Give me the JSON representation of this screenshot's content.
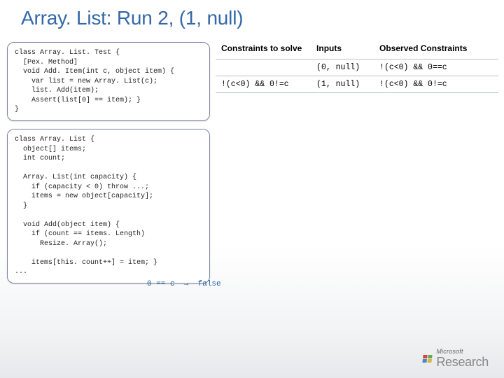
{
  "title": "Array. List: Run 2, (1, null)",
  "code1": "class Array. List. Test {\n  [Pex. Method]\n  void Add. Item(int c, object item) {\n    var list = new Array. List(c);\n    list. Add(item);\n    Assert(list[0] == item); }\n}",
  "code2": "class Array. List {\n  object[] items;\n  int count;\n\n  Array. List(int capacity) {\n    if (capacity < 0) throw ...;\n    items = new object[capacity];\n  }\n\n  void Add(object item) {\n    if (count == items. Length)\n      Resize. Array();\n\n    items[this. count++] = item; }\n...",
  "annotation1": "0 == c  →  false",
  "table": {
    "headers": {
      "c1": "Constraints to solve",
      "c2": "Inputs",
      "c3": "Observed Constraints"
    },
    "rows": [
      {
        "c1": "",
        "c2": "(0, null)",
        "c3": "!(c<0) && 0==c"
      },
      {
        "c1": "!(c<0) && 0!=c",
        "c2": "(1, null)",
        "c3": "!(c<0) && 0!=c"
      }
    ]
  },
  "footer": {
    "brand": "Microsoft",
    "sub": "Research"
  }
}
